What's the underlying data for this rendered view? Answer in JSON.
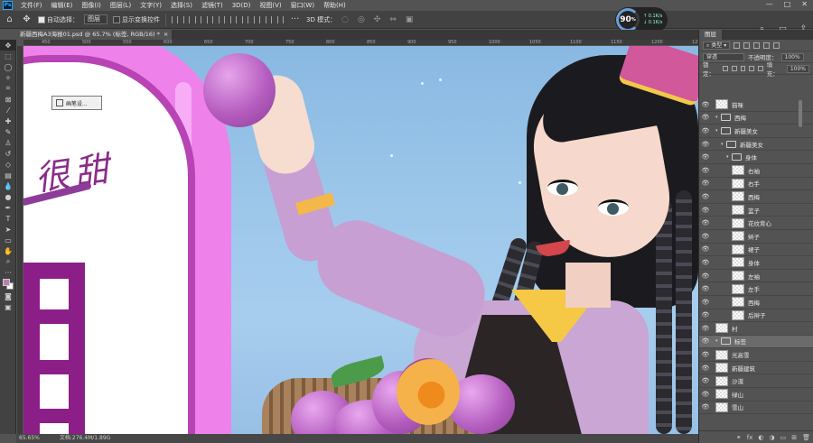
{
  "app": {
    "logo": "Ps"
  },
  "menu": [
    "文件(F)",
    "编辑(E)",
    "图像(I)",
    "图层(L)",
    "文字(Y)",
    "选择(S)",
    "滤镜(T)",
    "3D(D)",
    "视图(V)",
    "窗口(W)",
    "帮助(H)"
  ],
  "window_controls": [
    "—",
    "□",
    "✕"
  ],
  "options": {
    "move_icon": "move-icon",
    "auto_select_label": "自动选择：",
    "auto_select_value": "图层",
    "show_transform_label": "显示变换控件",
    "mode3d_label": "3D 模式："
  },
  "performance": {
    "percent": "90",
    "unit": "%",
    "line1": "↑ 0.1K/s",
    "line2": "↓ 0.1K/s"
  },
  "document": {
    "tab_title": "新疆西梅A3海报01.psd @ 65.7% (标签, RGB/16) *",
    "close": "×"
  },
  "canvas_popup": {
    "label": "画笔设..."
  },
  "poster": {
    "text": "很甜"
  },
  "ruler_numbers": [
    "450",
    "500",
    "550",
    "600",
    "650",
    "700",
    "750",
    "800",
    "850",
    "900",
    "950",
    "1000",
    "1050",
    "1100",
    "1150",
    "1200",
    "1250"
  ],
  "status": {
    "zoom": "65.65%",
    "doc": "文档:276.4M/1.89G"
  },
  "layers_panel": {
    "tab": "图层",
    "kind_label": "类型",
    "blend_mode": "穿透",
    "opacity_label": "不透明度：",
    "opacity_value": "100%",
    "lock_label": "锁定：",
    "fill_label": "填充：",
    "fill_value": "100%",
    "layers": [
      {
        "name": "猫咪",
        "type": "layer",
        "indent": 0
      },
      {
        "name": "西梅",
        "type": "folder",
        "indent": 0
      },
      {
        "name": "新疆美女",
        "type": "folder",
        "indent": 0
      },
      {
        "name": "新疆美女",
        "type": "folder",
        "indent": 1
      },
      {
        "name": "身体",
        "type": "folder",
        "indent": 2
      },
      {
        "name": "右袖",
        "type": "layer",
        "indent": 3
      },
      {
        "name": "右手",
        "type": "layer",
        "indent": 3
      },
      {
        "name": "西梅",
        "type": "layer",
        "indent": 3
      },
      {
        "name": "篮子",
        "type": "layer",
        "indent": 3
      },
      {
        "name": "花纹背心",
        "type": "layer",
        "indent": 3
      },
      {
        "name": "辫子",
        "type": "layer",
        "indent": 3
      },
      {
        "name": "裙子",
        "type": "layer",
        "indent": 3
      },
      {
        "name": "身体",
        "type": "layer",
        "indent": 3
      },
      {
        "name": "左袖",
        "type": "layer",
        "indent": 3
      },
      {
        "name": "左手",
        "type": "layer",
        "indent": 3
      },
      {
        "name": "西梅",
        "type": "layer",
        "indent": 3
      },
      {
        "name": "后辫子",
        "type": "layer",
        "indent": 3
      },
      {
        "name": "村",
        "type": "layer",
        "indent": 0
      },
      {
        "name": "标签",
        "type": "folder",
        "indent": 0,
        "selected": true
      },
      {
        "name": "光高雪",
        "type": "layer",
        "indent": 0
      },
      {
        "name": "新疆建筑",
        "type": "layer",
        "indent": 0
      },
      {
        "name": "沙漠",
        "type": "layer",
        "indent": 0
      },
      {
        "name": "绿山",
        "type": "layer",
        "indent": 0
      },
      {
        "name": "雪山",
        "type": "layer",
        "indent": 0
      }
    ],
    "footer_icons": [
      "link-icon",
      "fx-icon",
      "mask-icon",
      "adjustment-icon",
      "group-icon",
      "new-layer-icon",
      "trash-icon"
    ]
  },
  "colors": {
    "accent": "#31a8ff",
    "panel": "#535353",
    "poster_pink": "#ee82ea",
    "poster_purple": "#8c1f87"
  }
}
